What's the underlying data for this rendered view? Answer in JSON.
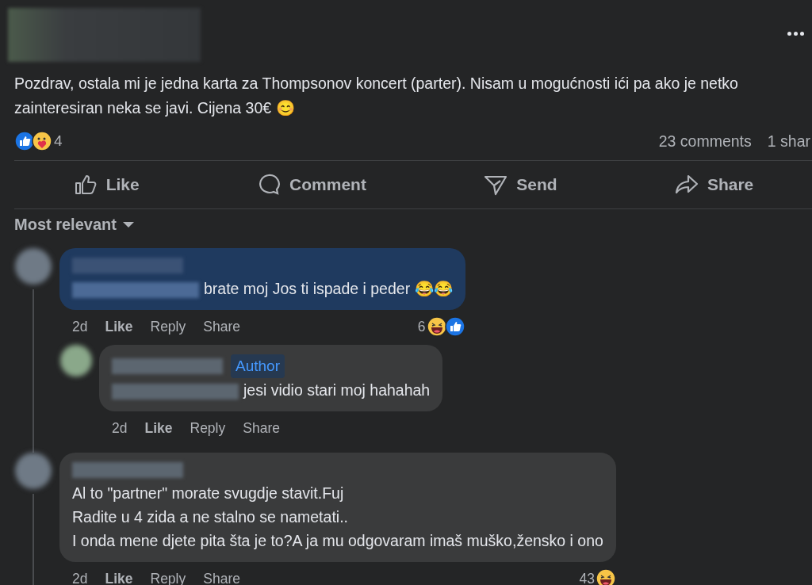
{
  "post": {
    "text": "Pozdrav, ostala mi je jedna karta za Thompsonov koncert (parter). Nisam u mogućnosti ići pa ako je netko zainteresiran neka se javi. Cijena 30€ 😊"
  },
  "reactions": {
    "count": "4"
  },
  "stats": {
    "comments": "23 comments",
    "shares": "1 shar"
  },
  "actions": [
    {
      "kind": "like",
      "label": "Like"
    },
    {
      "kind": "comment",
      "label": "Comment"
    },
    {
      "kind": "send",
      "label": "Send"
    },
    {
      "kind": "share",
      "label": "Share"
    }
  ],
  "sort": {
    "label": "Most relevant"
  },
  "comments": [
    {
      "highlighted": true,
      "mention": true,
      "lines": [
        "brate moj Jos ti ispade i peder 😂😂"
      ],
      "time": "2d",
      "actions": [
        "Like",
        "Reply",
        "Share"
      ],
      "reaction_count": "6",
      "children": [
        {
          "highlighted": false,
          "mention": true,
          "badge": "Author",
          "lines": [
            "jesi vidio stari moj hahahah"
          ],
          "time": "2d",
          "actions": [
            "Like",
            "Reply",
            "Share"
          ]
        }
      ]
    },
    {
      "highlighted": false,
      "mention": false,
      "lines": [
        "Al to \"partner\" morate svugdje stavit.Fuj",
        "Radite u 4 zida a ne stalno se nametati..",
        "I onda mene djete pita šta je to?A ja mu odgovaram imaš muško,žensko i ono"
      ],
      "time": "2d",
      "actions": [
        "Like",
        "Reply",
        "Share"
      ],
      "reaction_count": "43"
    }
  ]
}
